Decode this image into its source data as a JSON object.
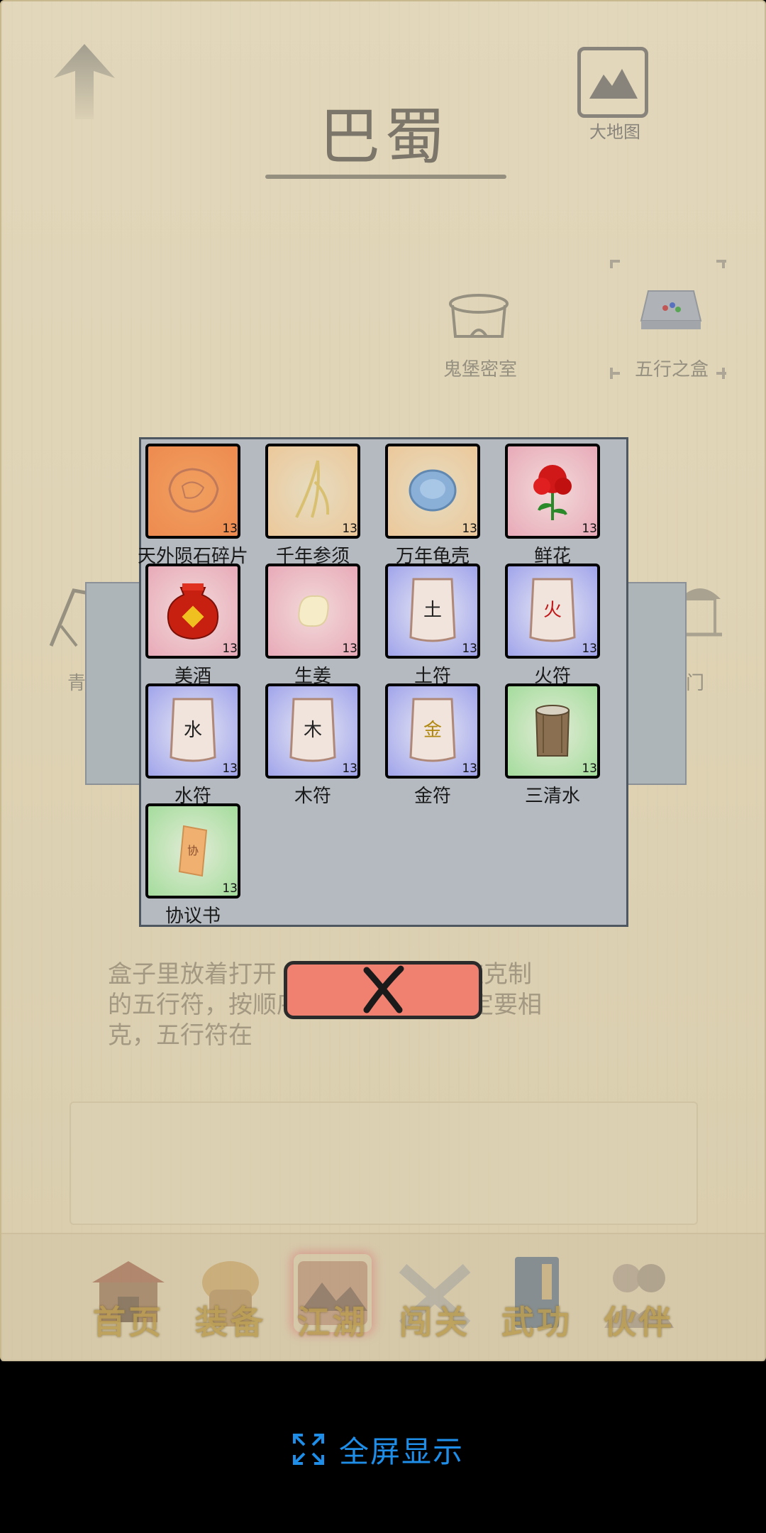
{
  "header": {
    "title": "巴蜀",
    "map_label": "大地图"
  },
  "locations": [
    {
      "label": "鬼堡密室"
    },
    {
      "label": "五行之盒"
    },
    {
      "label": "青"
    },
    {
      "label": "门"
    }
  ],
  "description": "盒子里放着打开鬼堡密室的钥匙，用对应克制的五行符，按顺序放入。记住，一定要相克，五行符在",
  "description_visible": [
    "盒子里放着打开",
    "用对应克制",
    "的五行符，按顺序放入。记住，一定要相",
    "克，五行符在"
  ],
  "inventory": {
    "items": [
      {
        "name": "天外陨石碎片",
        "count": "13",
        "quality": "orange",
        "icon": "meteorite-icon"
      },
      {
        "name": "千年参须",
        "count": "13",
        "quality": "gold",
        "icon": "ginseng-icon"
      },
      {
        "name": "万年龟壳",
        "count": "13",
        "quality": "gold",
        "icon": "turtle-shell-icon"
      },
      {
        "name": "鲜花",
        "count": "13",
        "quality": "red",
        "icon": "flower-icon"
      },
      {
        "name": "美酒",
        "count": "13",
        "quality": "red",
        "icon": "wine-jar-icon"
      },
      {
        "name": "生姜",
        "count": "13",
        "quality": "red",
        "icon": "ginger-icon"
      },
      {
        "name": "土符",
        "count": "13",
        "quality": "blue",
        "icon": "talisman-icon",
        "glyph": "土"
      },
      {
        "name": "火符",
        "count": "13",
        "quality": "blue",
        "icon": "talisman-icon",
        "glyph": "火"
      },
      {
        "name": "水符",
        "count": "13",
        "quality": "blue",
        "icon": "talisman-icon",
        "glyph": "水"
      },
      {
        "name": "木符",
        "count": "13",
        "quality": "blue",
        "icon": "talisman-icon",
        "glyph": "木"
      },
      {
        "name": "金符",
        "count": "13",
        "quality": "blue",
        "icon": "talisman-icon",
        "glyph": "金"
      },
      {
        "name": "三清水",
        "count": "13",
        "quality": "green",
        "icon": "bucket-icon"
      },
      {
        "name": "协议书",
        "count": "13",
        "quality": "green",
        "icon": "contract-icon",
        "glyph": "协"
      }
    ]
  },
  "nav": {
    "items": [
      {
        "label": "首页",
        "icon": "home-icon",
        "active": false
      },
      {
        "label": "装备",
        "icon": "armor-icon",
        "active": false
      },
      {
        "label": "江湖",
        "icon": "jianghu-icon",
        "active": true
      },
      {
        "label": "闯关",
        "icon": "swords-icon",
        "active": false
      },
      {
        "label": "武功",
        "icon": "book-icon",
        "active": false
      },
      {
        "label": "伙伴",
        "icon": "partners-icon",
        "active": false
      }
    ]
  },
  "fullscreen": {
    "label": "全屏显示"
  },
  "colors": {
    "accent_blue": "#1e8ee8",
    "nav_gold": "#b8953c",
    "close_button": "#f08070"
  }
}
